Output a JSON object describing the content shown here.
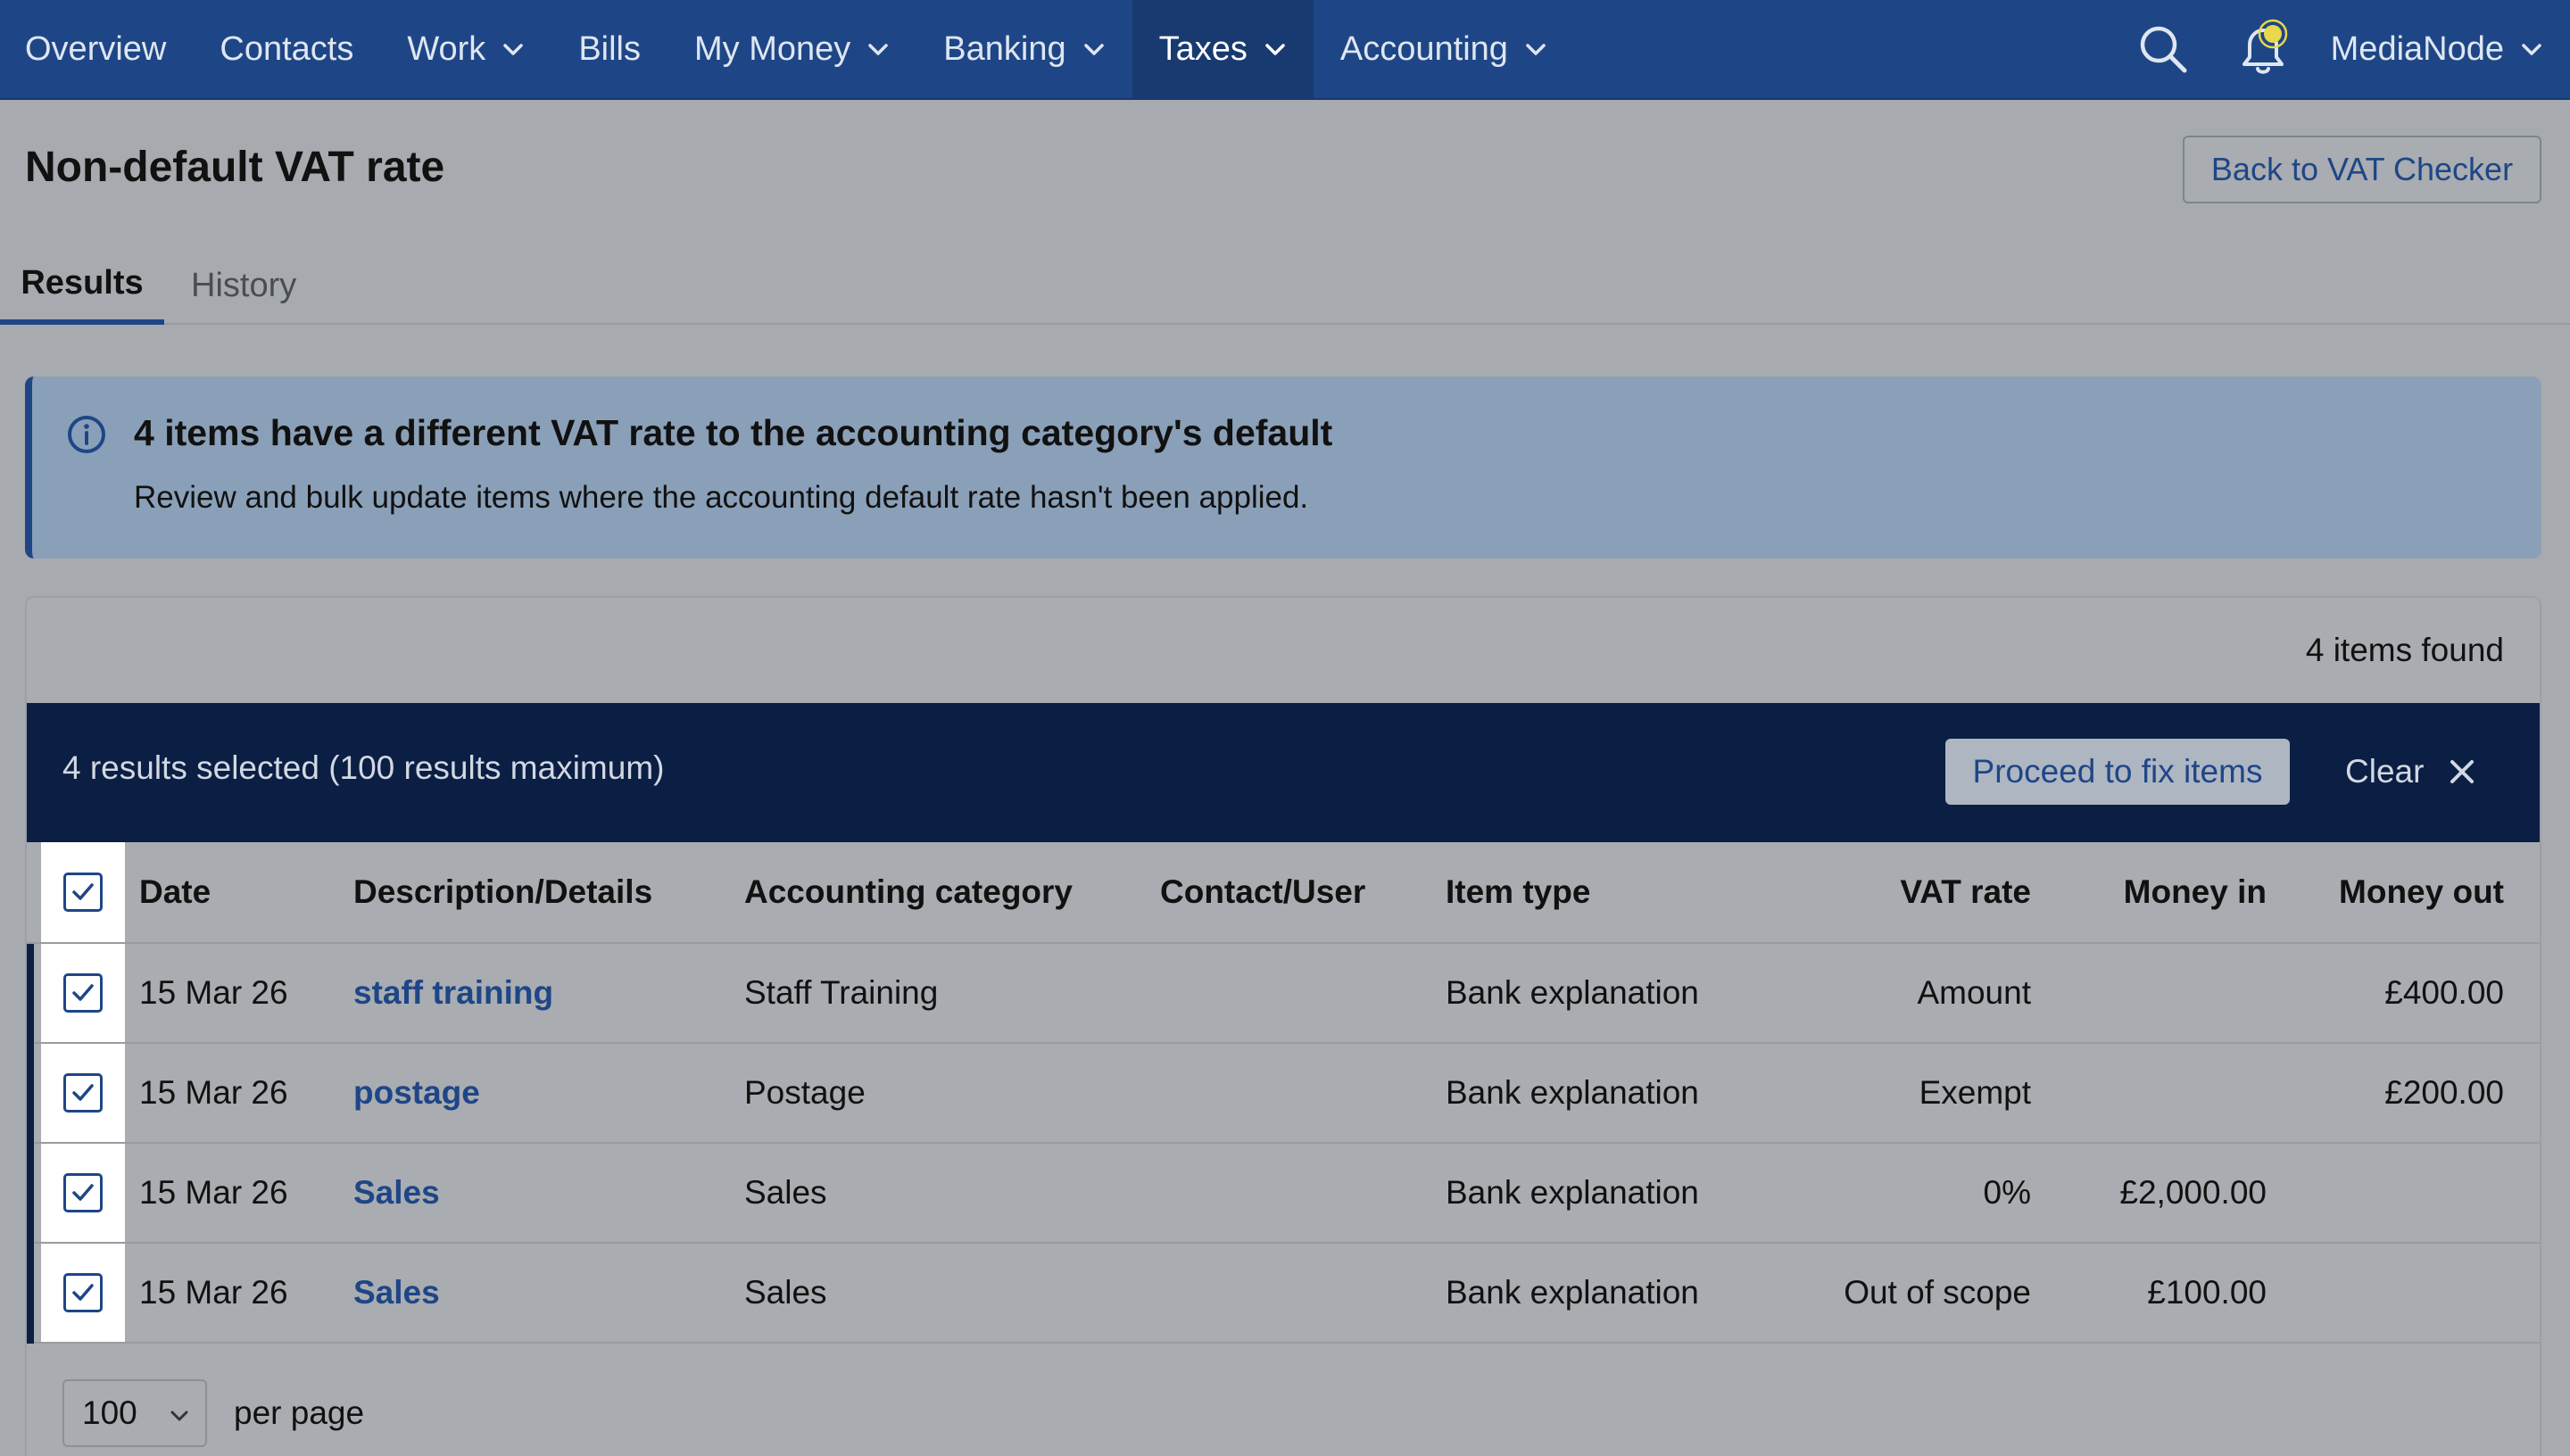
{
  "nav": {
    "items": [
      {
        "label": "Overview",
        "dropdown": false,
        "active": false
      },
      {
        "label": "Contacts",
        "dropdown": false,
        "active": false
      },
      {
        "label": "Work",
        "dropdown": true,
        "active": false
      },
      {
        "label": "Bills",
        "dropdown": false,
        "active": false
      },
      {
        "label": "My Money",
        "dropdown": true,
        "active": false
      },
      {
        "label": "Banking",
        "dropdown": true,
        "active": false
      },
      {
        "label": "Taxes",
        "dropdown": true,
        "active": true
      },
      {
        "label": "Accounting",
        "dropdown": true,
        "active": false
      }
    ],
    "account_label": "MediaNode",
    "icons": [
      "search-icon",
      "bell-icon"
    ]
  },
  "header": {
    "title": "Non-default VAT rate",
    "back_button": "Back to VAT Checker"
  },
  "tabs": [
    {
      "label": "Results",
      "active": true
    },
    {
      "label": "History",
      "active": false
    }
  ],
  "banner": {
    "title": "4 items have a different VAT rate to the accounting category's default",
    "text": "Review and bulk update items where the accounting default rate hasn't been applied."
  },
  "results": {
    "count_label": "4 items found",
    "selection_text": "4 results selected (100 results maximum)",
    "proceed_button": "Proceed to fix items",
    "clear_button": "Clear"
  },
  "table": {
    "columns": {
      "date": "Date",
      "description": "Description/Details",
      "category": "Accounting category",
      "contact": "Contact/User",
      "item_type": "Item type",
      "vat_rate": "VAT rate",
      "money_in": "Money in",
      "money_out": "Money out"
    },
    "rows": [
      {
        "date": "15 Mar 26",
        "description": "staff training",
        "category": "Staff Training",
        "contact": "",
        "item_type": "Bank explanation",
        "vat_rate": "Amount",
        "money_in": "",
        "money_out": "£400.00",
        "checked": true
      },
      {
        "date": "15 Mar 26",
        "description": "postage",
        "category": "Postage",
        "contact": "",
        "item_type": "Bank explanation",
        "vat_rate": "Exempt",
        "money_in": "",
        "money_out": "£200.00",
        "checked": true
      },
      {
        "date": "15 Mar 26",
        "description": "Sales",
        "category": "Sales",
        "contact": "",
        "item_type": "Bank explanation",
        "vat_rate": "0%",
        "money_in": "£2,000.00",
        "money_out": "",
        "checked": true
      },
      {
        "date": "15 Mar 26",
        "description": "Sales",
        "category": "Sales",
        "contact": "",
        "item_type": "Bank explanation",
        "vat_rate": "Out of scope",
        "money_in": "£100.00",
        "money_out": "",
        "checked": true
      }
    ]
  },
  "pagination": {
    "per_page_value": "100",
    "per_page_label": "per page"
  },
  "colors": {
    "nav_bg": "#1e4687",
    "accent": "#1e4687",
    "selection_bar": "#0b1e44",
    "banner_bg": "#8aa0b8",
    "notification_dot": "#e8d84a"
  }
}
